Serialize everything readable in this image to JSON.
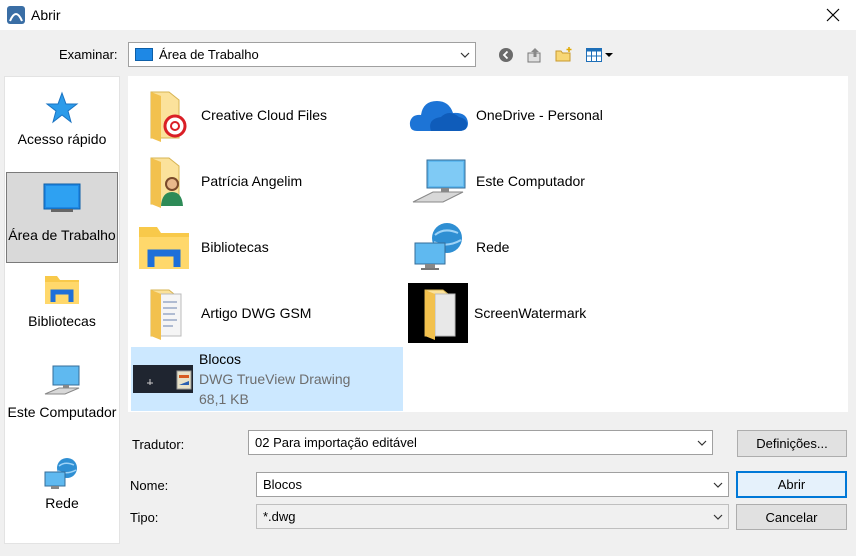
{
  "window": {
    "title": "Abrir"
  },
  "lookin": {
    "label": "Examinar:",
    "value": "Área de Trabalho"
  },
  "places": [
    {
      "label": "Acesso rápido",
      "icon": "star-icon"
    },
    {
      "label": "Área de Trabalho",
      "icon": "desktop-icon",
      "selected": true
    },
    {
      "label": "Bibliotecas",
      "icon": "libraries-icon"
    },
    {
      "label": "Este Computador",
      "icon": "computer-icon"
    },
    {
      "label": "Rede",
      "icon": "network-icon"
    }
  ],
  "files": [
    {
      "name": "Creative Cloud Files",
      "icon": "creative-cloud-folder-icon"
    },
    {
      "name": "OneDrive - Personal",
      "icon": "onedrive-cloud-icon"
    },
    {
      "name": "Patrícia Angelim",
      "icon": "user-folder-icon"
    },
    {
      "name": "Este Computador",
      "icon": "computer-icon"
    },
    {
      "name": "Bibliotecas",
      "icon": "libraries-folder-icon"
    },
    {
      "name": "Rede",
      "icon": "network-icon"
    },
    {
      "name": "Artigo DWG GSM",
      "icon": "document-folder-icon"
    },
    {
      "name": "ScreenWatermark",
      "icon": "folder-icon"
    },
    {
      "name": "Blocos",
      "type": "DWG TrueView Drawing",
      "size": "68,1 KB",
      "icon": "dwg-thumbnail-icon",
      "selected": true
    }
  ],
  "translator": {
    "label": "Tradutor:",
    "value": "02 Para importação editável",
    "settings_label": "Definições..."
  },
  "name_field": {
    "label": "Nome:",
    "value": "Blocos"
  },
  "type_field": {
    "label": "Tipo:",
    "value": "*.dwg"
  },
  "buttons": {
    "open": "Abrir",
    "cancel": "Cancelar"
  },
  "colors": {
    "selection": "#cce8ff",
    "accent": "#0078d7",
    "folder": "#f8d775"
  }
}
